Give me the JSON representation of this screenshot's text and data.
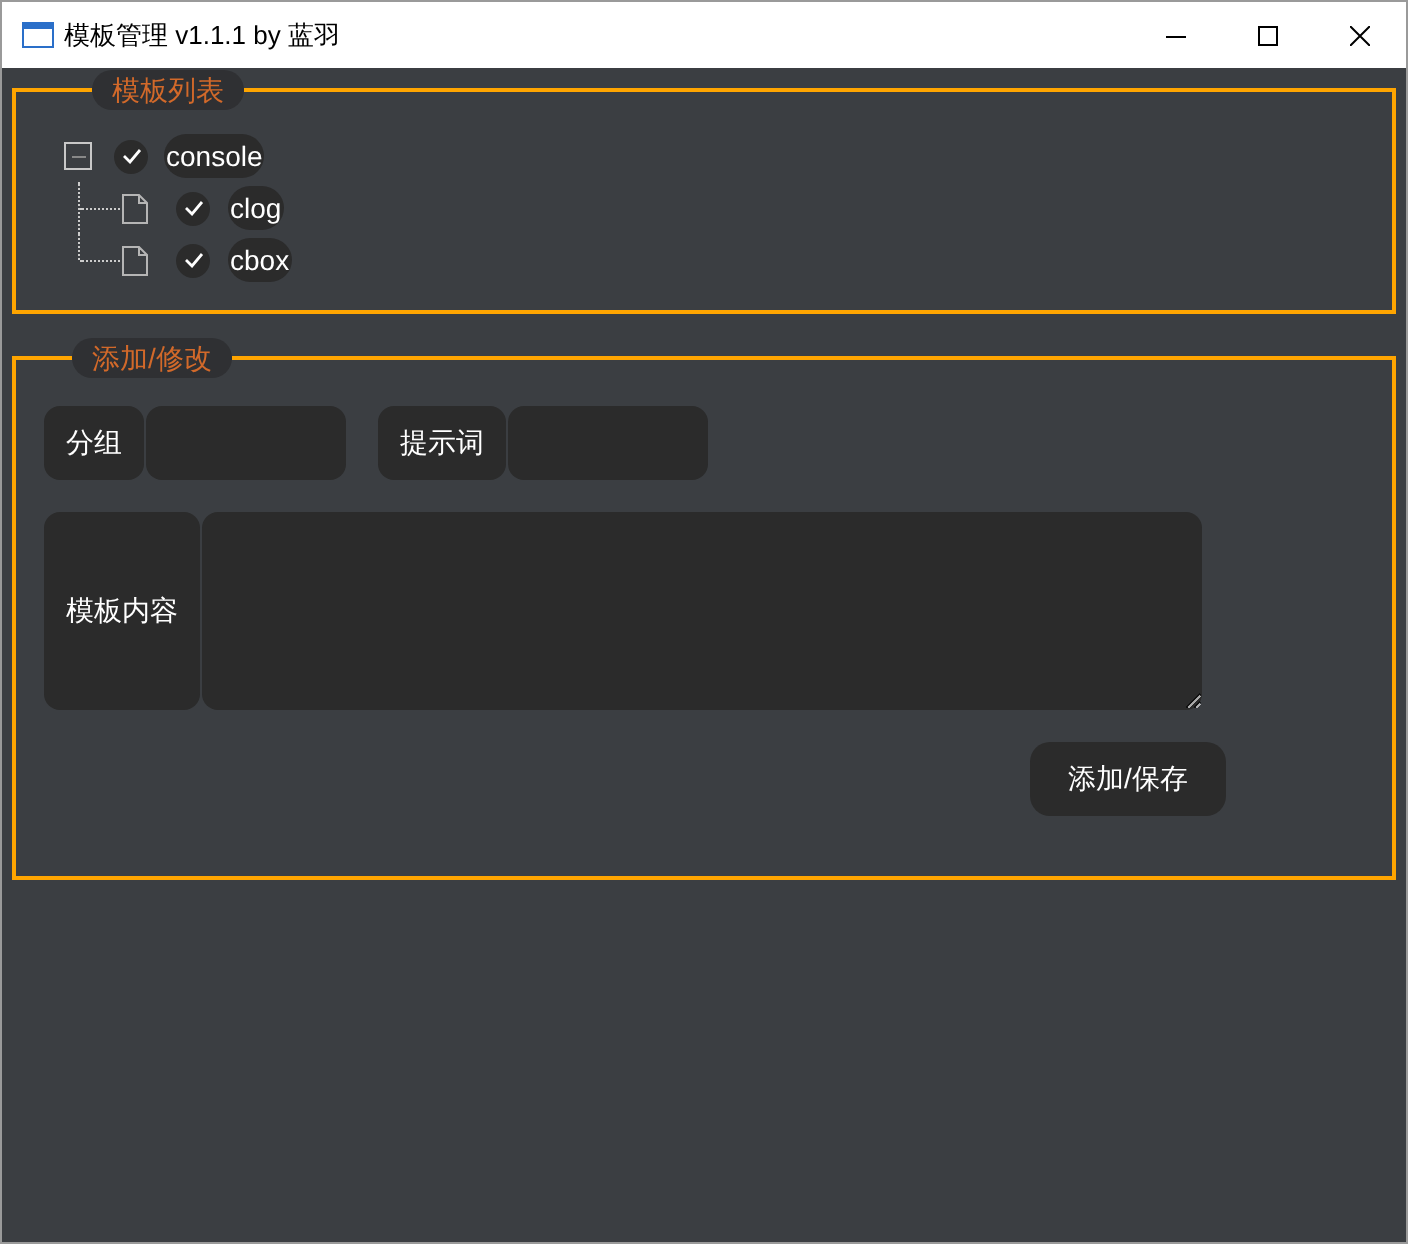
{
  "window": {
    "title": "模板管理 v1.1.1 by 蓝羽"
  },
  "template_list": {
    "legend": "模板列表",
    "tree": [
      {
        "label": "console",
        "checked": true,
        "expanded": true,
        "children": [
          {
            "label": "clog",
            "checked": true
          },
          {
            "label": "cbox",
            "checked": true
          }
        ]
      }
    ]
  },
  "editor": {
    "legend": "添加/修改",
    "fields": [
      {
        "label": "分组"
      },
      {
        "label": "提示词"
      }
    ],
    "content_label": "模板内容",
    "button": "添加/保存"
  }
}
